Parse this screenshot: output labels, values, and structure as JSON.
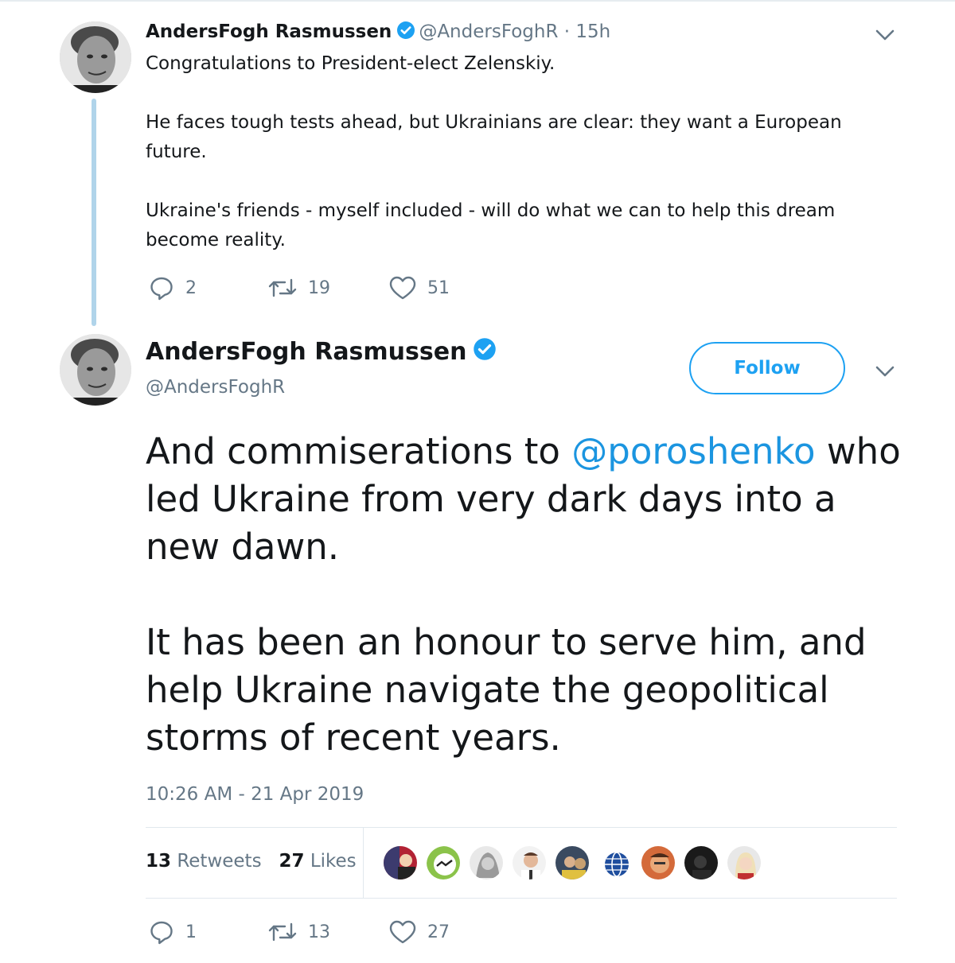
{
  "tweet1": {
    "display_name": "AndersFogh Rasmussen",
    "handle": "@AndersFoghR",
    "time": "· 15h",
    "text": "Congratulations to President-elect Zelenskiy.\n\nHe faces tough tests ahead, but Ukrainians are clear: they want a European future.\n\nUkraine's friends - myself included - will do what we can to help this dream become reality.",
    "replies": "2",
    "retweets": "19",
    "likes": "51"
  },
  "tweet2": {
    "display_name": "AndersFogh Rasmussen",
    "handle": "@AndersFoghR",
    "follow_label": "Follow",
    "text_part1_before": "And commiserations to ",
    "mention": "@poroshenko",
    "text_part1_after": " who led Ukraine from very dark days into a new dawn.",
    "text_part2": "It has been an honour to serve him, and help Ukraine navigate the geopolitical storms of recent years.",
    "timestamp": "10:26 AM - 21 Apr 2019",
    "retweet_count": "13",
    "retweet_label": "Retweets",
    "like_count": "27",
    "like_label": "Likes",
    "replies": "1",
    "retweets": "13",
    "likes": "27"
  },
  "icons": {
    "reply": "reply-icon",
    "retweet": "retweet-icon",
    "like": "heart-icon",
    "verified": "verified-badge-icon",
    "menu": "chevron-down-icon"
  },
  "colors": {
    "accent": "#1da1f2",
    "mention": "#1b95e0",
    "muted": "#657786",
    "thread_line": "#b0d4ea"
  }
}
